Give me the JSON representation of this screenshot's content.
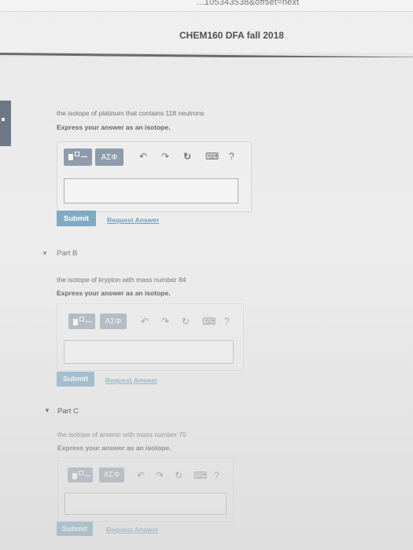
{
  "browser": {
    "url_fragment": "...105343538&offset=next"
  },
  "header": {
    "title": "CHEM160 DFA fall 2018"
  },
  "toolbar": {
    "greek_label": "ΑΣΦ",
    "undo_glyph": "↶",
    "redo_glyph": "↷",
    "reset_glyph": "↻",
    "keyboard_glyph": "⌨",
    "help_glyph": "?"
  },
  "partA": {
    "question": "the isotope of platinum that contains 118 neutrons",
    "instruction": "Express your answer as an isotope.",
    "answer_value": "",
    "submit_label": "Submit",
    "request_label": "Request Answer"
  },
  "partB": {
    "caret": "▼",
    "title": "Part B",
    "question": "the isotope of krypton with mass number 84",
    "instruction": "Express your answer as an isotope.",
    "answer_value": "",
    "submit_label": "Submit",
    "request_label": "Request Answer"
  },
  "partC": {
    "caret": "▼",
    "title": "Part C",
    "question": "the isotope of arsenic with mass number 75",
    "instruction": "Express your answer as an isotope.",
    "answer_value": "",
    "submit_label": "Submit",
    "request_label": "Request Answer"
  },
  "colors": {
    "submit_bg": "#3f7fa3",
    "toolbar_btn": "#5b6e86",
    "link": "#2d6a95"
  }
}
